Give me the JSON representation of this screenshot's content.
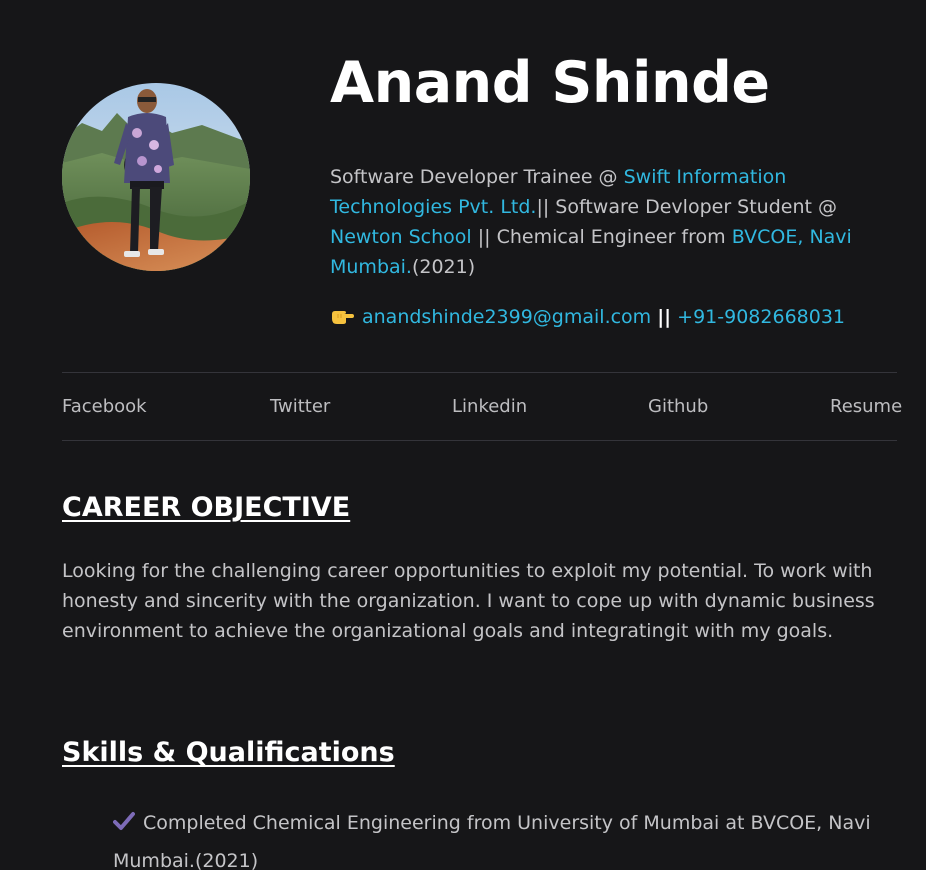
{
  "profile": {
    "name": "Anand Shinde",
    "bio": {
      "part1": "Software Developer Trainee @ ",
      "company": "Swift Information Technologies Pvt. Ltd.",
      "part2": "|| Software Devloper Student @ ",
      "school": "Newton School",
      "part3": " || Chemical Engineer from ",
      "college": "BVCOE, Navi Mumbai.",
      "part4": "(2021)"
    },
    "contact": {
      "icon": "pointing-hand-icon",
      "email": "anandshinde2399@gmail.com",
      "separator": "||",
      "phone": "+91-9082668031"
    },
    "avatar_icon": "profile-photo"
  },
  "nav": {
    "items": [
      {
        "label": "Facebook"
      },
      {
        "label": "Twitter"
      },
      {
        "label": "Linkedin"
      },
      {
        "label": "Github"
      },
      {
        "label": "Resume"
      }
    ]
  },
  "career": {
    "heading": "CAREER OBJECTIVE",
    "text": "Looking for the challenging career opportunities to exploit my potential. To work with honesty and sincerity with the organization. I want to cope up with dynamic business environment to achieve the organizational goals and integratingit with my goals."
  },
  "skills": {
    "heading": "Skills & Qualifications",
    "items": [
      {
        "icon": "check-mark-icon",
        "text": "Completed Chemical Engineering from University of Mumbai at BVCOE, Navi Mumbai.(2021)"
      }
    ]
  },
  "colors": {
    "background": "#161618",
    "link": "#31b8e0",
    "heading": "#ffffff",
    "body_text": "#c4c4c7",
    "check": "#7d6bb8"
  }
}
